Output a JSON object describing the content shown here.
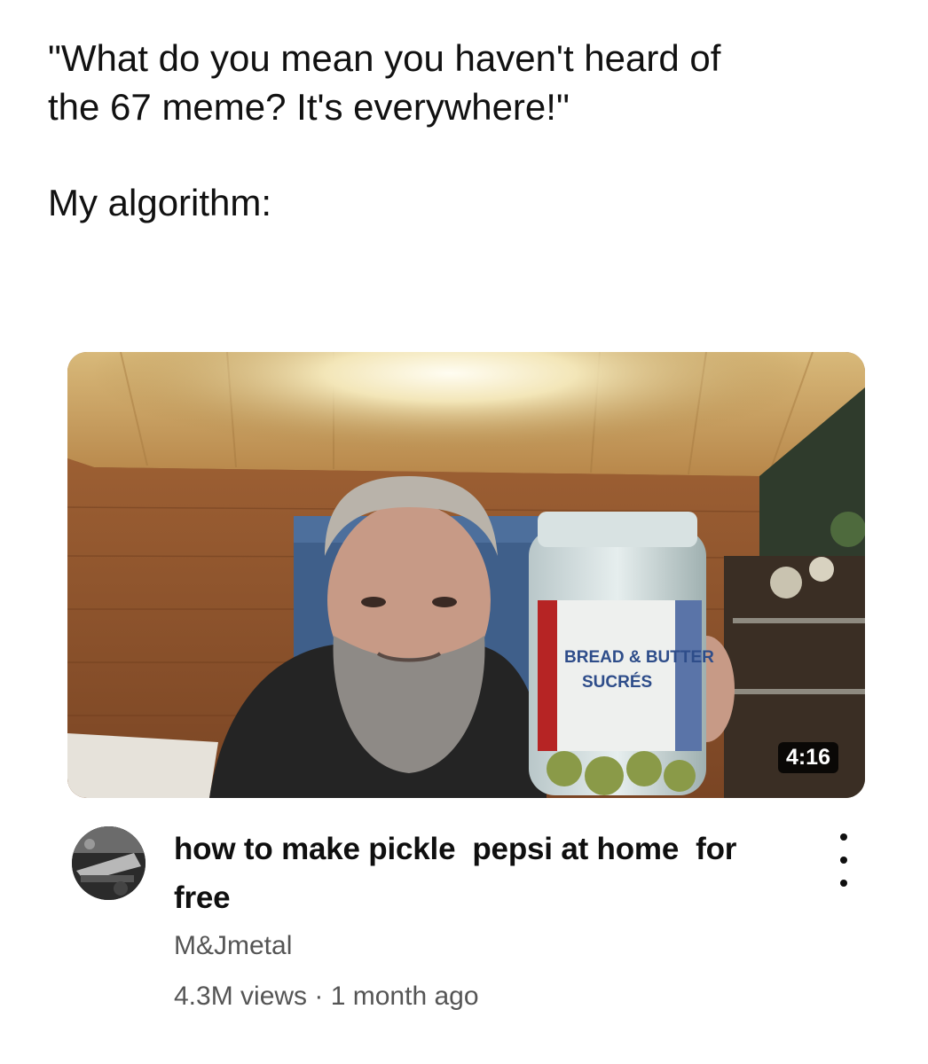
{
  "caption": {
    "line1": "\"What do you mean you haven't heard of\nthe 67 meme? It's everywhere!\"",
    "line2": "My algorithm:"
  },
  "video": {
    "duration": "4:16",
    "title": "how to make pickle  pepsi at home  for free",
    "channel": "M&Jmetal",
    "views": "4.3M views",
    "separator": "·",
    "age": "1 month ago",
    "more_icon": "vertical-ellipsis-icon"
  },
  "jar_label": {
    "line1": "BREAD & BUTTER",
    "line2": "SUCRÉS"
  }
}
